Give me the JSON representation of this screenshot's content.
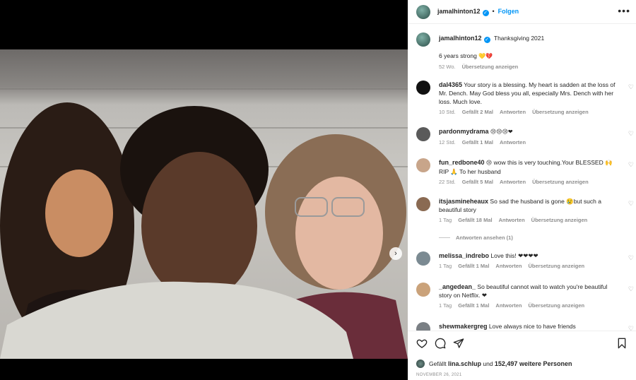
{
  "post": {
    "owner": "jamalhinton12",
    "follow_label": "Folgen",
    "more_label": "•••",
    "caption_title": "Thanksgiving 2021",
    "caption_body": "6 years strong",
    "caption_emojis": "💛💔",
    "caption_age": "52 Wo.",
    "translate_label": "Übersetzung anzeigen"
  },
  "comments": [
    {
      "user": "dal4365",
      "text": "Your story is a blessing. My heart is sadden at the loss of Mr. Dench. May God bless you all, especially Mrs. Dench with her loss. Much love.",
      "age": "10 Std.",
      "likes": "Gefällt 2 Mal",
      "reply": "Antworten",
      "translate": "Übersetzung anzeigen"
    },
    {
      "user": "pardonmydrama",
      "text": "",
      "emojis": "😢😢😢❤",
      "age": "12 Std.",
      "likes": "Gefällt 1 Mal",
      "reply": "Antworten",
      "translate": ""
    },
    {
      "user": "fun_redbone40",
      "text": "wow this is very touching.Your BLESSED 🙌 RIP 🙏 To her husband",
      "lead_emoji": "😢",
      "age": "22 Std.",
      "likes": "Gefällt 5 Mal",
      "reply": "Antworten",
      "translate": "Übersetzung anzeigen"
    },
    {
      "user": "itsjasmineheaux",
      "text": "So sad the husband is gone 😢but such a beautiful story",
      "age": "1 Tag",
      "likes": "Gefällt 18 Mal",
      "reply": "Antworten",
      "translate": "Übersetzung anzeigen",
      "view_replies": "Antworten ansehen (1)"
    },
    {
      "user": "melissa_indrebo",
      "text": "Love this! ❤❤❤❤",
      "age": "1 Tag",
      "likes": "Gefällt 1 Mal",
      "reply": "Antworten",
      "translate": "Übersetzung anzeigen"
    },
    {
      "user": "_angedean_",
      "text": "So beautiful cannot wait to watch you're beautiful story on Netflix. ❤",
      "age": "1 Tag",
      "likes": "Gefällt 1 Mal",
      "reply": "Antworten",
      "translate": "Übersetzung anzeigen"
    },
    {
      "user": "shewmakergreg",
      "text": "Love always nice to have friends",
      "age": "",
      "likes": "",
      "reply": "",
      "translate": ""
    }
  ],
  "footer": {
    "liked_prefix": "Gefällt",
    "liked_user": "lina.schlup",
    "liked_suffix": "und",
    "liked_count": "152,497 weitere Personen",
    "date": "NOVEMBER 26, 2021"
  },
  "icons": {
    "heart": "heart-icon",
    "comment": "comment-icon",
    "share": "share-icon",
    "save": "bookmark-icon",
    "next": "chevron-right-icon"
  },
  "colors": {
    "link": "#0095f6",
    "muted": "#8e8e8e",
    "heart": "#ed4956"
  }
}
